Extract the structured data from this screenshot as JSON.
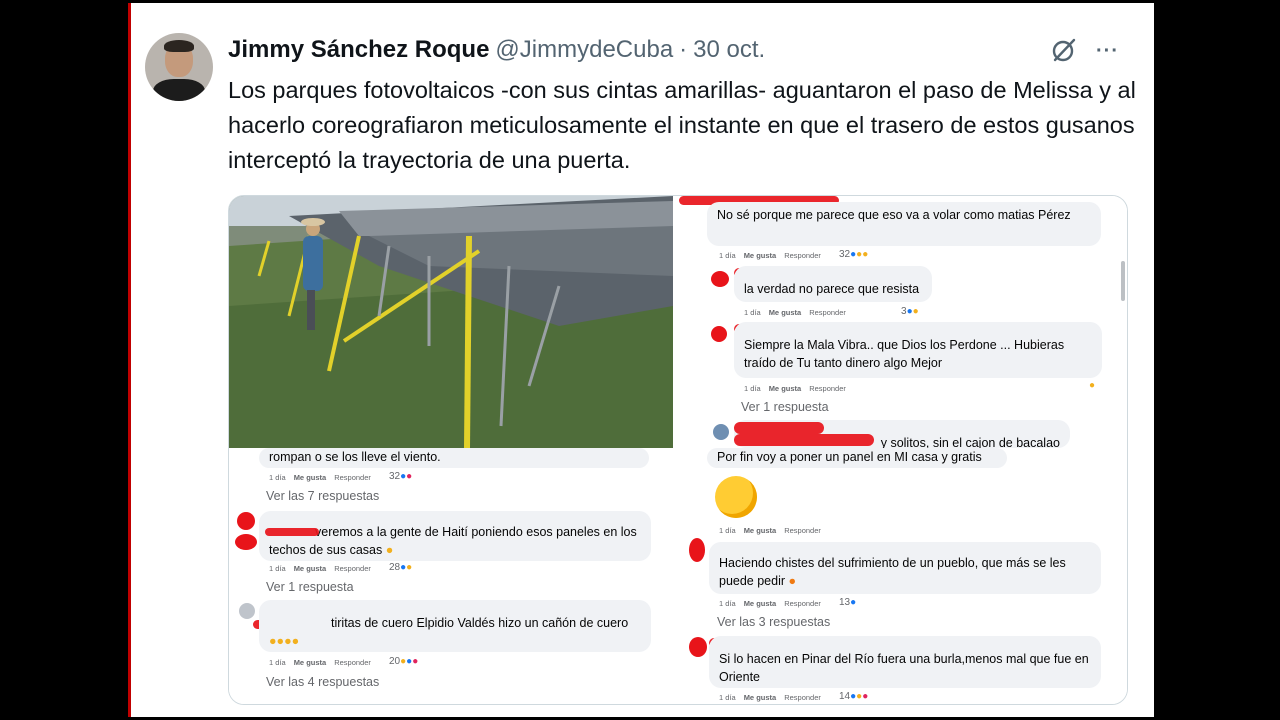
{
  "tweet": {
    "name": "Jimmy Sánchez Roque",
    "handle": "@JimmydeCuba",
    "separator": "·",
    "date": "30 oct.",
    "more": "···",
    "text": "Los parques fotovoltaicos -con sus cintas amarillas- aguantaron el paso de Melissa y al hacerlo coreografiaron meticulosamente el instante en que el trasero de estos gusanos interceptó la trayectoria de una puerta."
  },
  "icons": {
    "avatar": "profile-photo",
    "grok": "grok-icon",
    "more": "more-icon"
  },
  "comments_right": [
    {
      "text": "No sé porque me parece que eso va a volar como matias Pérez",
      "meta": {
        "time": "1 día",
        "like": "Me gusta",
        "reply": "Responder"
      },
      "reactions": "32"
    },
    {
      "text": "la verdad no parece que resista",
      "meta": {
        "time": "1 día",
        "like": "Me gusta",
        "reply": "Responder"
      },
      "reactions": "3"
    },
    {
      "text": "Siempre la Mala Vibra.. que Dios los Perdone ... Hubieras traído de Tu tanto dinero algo Mejor",
      "meta": {
        "time": "1 día",
        "like": "Me gusta",
        "reply": "Responder"
      },
      "replies": "Ver 1 respuesta"
    },
    {
      "text": "y solitos, sin el cajon de bacalao"
    },
    {
      "text": "Por fin voy a poner un panel en MI casa y gratis",
      "meta": {
        "time": "1 día",
        "like": "Me gusta",
        "reply": "Responder"
      }
    },
    {
      "text": "Haciendo chistes del sufrimiento de un pueblo, que más se les puede pedir",
      "meta": {
        "time": "1 día",
        "like": "Me gusta",
        "reply": "Responder"
      },
      "reactions": "13",
      "replies": "Ver las 3 respuestas"
    },
    {
      "text": "Si lo hacen en Pinar del Río fuera una burla,menos mal que fue en Oriente",
      "meta": {
        "time": "1 día",
        "like": "Me gusta",
        "reply": "Responder"
      },
      "reactions": "14"
    }
  ],
  "comments_left": [
    {
      "text": "rompan o se los lleve el viento.",
      "meta": {
        "time": "1 día",
        "like": "Me gusta",
        "reply": "Responder"
      },
      "reactions": "32",
      "replies": "Ver las 7 respuestas"
    },
    {
      "text": "veremos a la gente de Haití poniendo esos paneles en los techos de sus casas",
      "meta": {
        "time": "1 día",
        "like": "Me gusta",
        "reply": "Responder"
      },
      "reactions": "28",
      "replies": "Ver 1 respuesta"
    },
    {
      "text": "tiritas de cuero Elpidio Valdés hizo un cañón de cuero",
      "meta": {
        "time": "1 día",
        "like": "Me gusta",
        "reply": "Responder"
      },
      "reactions": "20",
      "replies": "Ver las 4 respuestas"
    }
  ],
  "colors": {
    "accent": "#1d9bf0",
    "redaction": "#e8141a",
    "tape": "#e2d12a"
  }
}
